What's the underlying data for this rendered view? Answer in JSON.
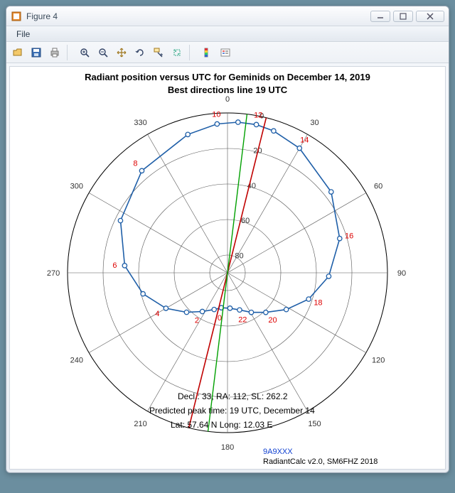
{
  "window": {
    "title": "Figure 4"
  },
  "menu": {
    "file": "File"
  },
  "toolbar_icons": [
    "open-icon",
    "save-icon",
    "print-icon",
    "zoom-in-icon",
    "zoom-out-icon",
    "pan-icon",
    "rotate-icon",
    "data-cursor-icon",
    "brush-icon",
    "insert-colorbar-icon",
    "insert-legend-icon"
  ],
  "chart_data": {
    "type": "polar",
    "title_line1": "Radiant position versus UTC for Geminids on December 14, 2019",
    "title_line2": "Best directions line 19 UTC",
    "azimuth_ticks": [
      0,
      30,
      60,
      90,
      120,
      150,
      180,
      210,
      240,
      270,
      300,
      330
    ],
    "radial_ticks": [
      0,
      20,
      40,
      60,
      80
    ],
    "radial_label_offsets": {
      "0": 0,
      "20": 20,
      "40": 40,
      "60": 60,
      "80": 80
    },
    "hour_labels": [
      0,
      2,
      4,
      6,
      8,
      10,
      12,
      14,
      16,
      18,
      20,
      22
    ],
    "radiant_curve": [
      {
        "utc": 0,
        "az": 190,
        "r": 70
      },
      {
        "utc": 1,
        "az": 200,
        "r": 68
      },
      {
        "utc": 2,
        "az": 213,
        "r": 64
      },
      {
        "utc": 3,
        "az": 226,
        "r": 58
      },
      {
        "utc": 4,
        "az": 240,
        "r": 50
      },
      {
        "utc": 5,
        "az": 256,
        "r": 41
      },
      {
        "utc": 6,
        "az": 274,
        "r": 32
      },
      {
        "utc": 7,
        "az": 296,
        "r": 23
      },
      {
        "utc": 8,
        "az": 320,
        "r": 15
      },
      {
        "utc": 9,
        "az": 344,
        "r": 9
      },
      {
        "utc": 10,
        "az": 356,
        "r": 6
      },
      {
        "utc": 11,
        "az": 4,
        "r": 5
      },
      {
        "utc": 12,
        "az": 11,
        "r": 5
      },
      {
        "utc": 13,
        "az": 18,
        "r": 6
      },
      {
        "utc": 14,
        "az": 30,
        "r": 9
      },
      {
        "utc": 15,
        "az": 52,
        "r": 16
      },
      {
        "utc": 16,
        "az": 73,
        "r": 24
      },
      {
        "utc": 17,
        "az": 92,
        "r": 33
      },
      {
        "utc": 18,
        "az": 108,
        "r": 42
      },
      {
        "utc": 19,
        "az": 122,
        "r": 51
      },
      {
        "utc": 20,
        "az": 136,
        "r": 59
      },
      {
        "utc": 21,
        "az": 149,
        "r": 64
      },
      {
        "utc": 22,
        "az": 162,
        "r": 68
      },
      {
        "utc": 23,
        "az": 176,
        "r": 70
      }
    ],
    "best_direction_line": {
      "az1": 14,
      "az2": 194,
      "color": "#c00000"
    },
    "reference_line": {
      "az1": 7,
      "az2": 187,
      "color": "#00a000"
    },
    "info_lines": {
      "decl_ra": "Decl.: 33, RA: 112, SL: 262.2",
      "peak": "Predicted peak time: 19 UTC, December 14",
      "latlong": "Lat: 57.64 N Long: 12.03 E"
    },
    "callsign": "9A9XXX",
    "credit": "RadiantCalc v2.0, SM6FHZ 2018"
  }
}
